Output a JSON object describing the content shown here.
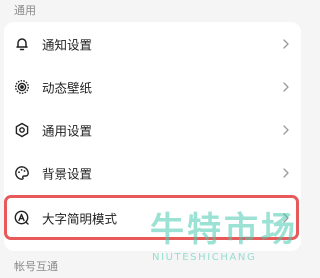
{
  "sections": {
    "general": "通用",
    "account": "帐号互通"
  },
  "settings": {
    "items": [
      {
        "label": "通知设置",
        "icon": "bell-icon"
      },
      {
        "label": "动态壁纸",
        "icon": "dynamic-wallpaper-icon"
      },
      {
        "label": "通用设置",
        "icon": "gear-icon"
      },
      {
        "label": "背景设置",
        "icon": "palette-icon"
      },
      {
        "label": "大字简明模式",
        "icon": "large-font-icon"
      }
    ]
  },
  "colors": {
    "highlight": "#e8595a",
    "watermark": "#48c9b0"
  },
  "watermark": {
    "title": "牛特市场",
    "subtitle": "NIUTESHICHANG"
  }
}
